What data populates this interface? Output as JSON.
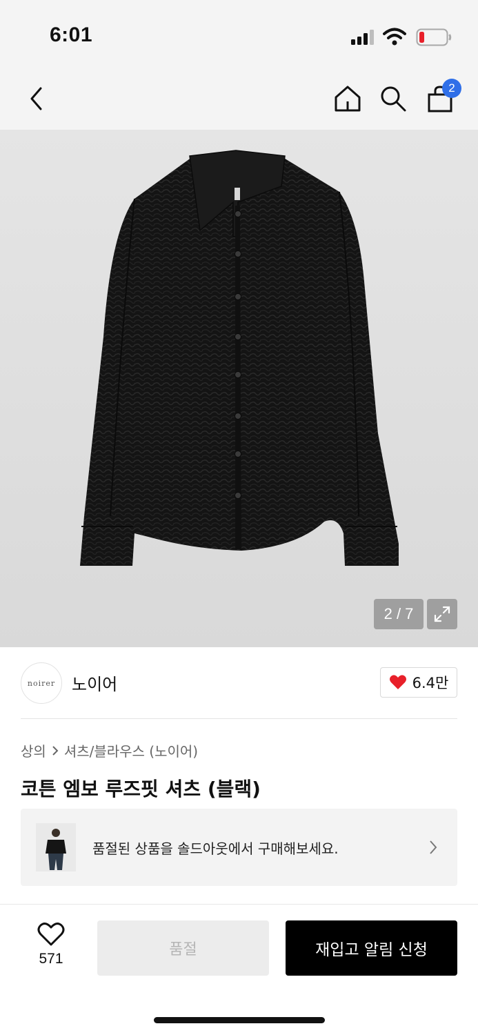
{
  "status_bar": {
    "time": "6:01"
  },
  "nav": {
    "cart_count": "2"
  },
  "gallery": {
    "counter": "2 / 7"
  },
  "brand": {
    "logo_text": "noirer",
    "name": "노이어",
    "likes": "6.4만"
  },
  "breadcrumb": {
    "category": "상의",
    "subcategory": "셔츠/블라우스 (노이어)"
  },
  "product": {
    "title": "코튼 엠보 루즈핏 셔츠 (블랙)"
  },
  "soldout_banner": {
    "text": "품절된 상품을 솔드아웃에서 구매해보세요."
  },
  "bottom_bar": {
    "wish_count": "571",
    "soldout_label": "품절",
    "restock_label": "재입고 알림 신청"
  },
  "colors": {
    "badge": "#2f6fe8",
    "heart": "#e8202a",
    "battery_low": "#e8202a"
  }
}
